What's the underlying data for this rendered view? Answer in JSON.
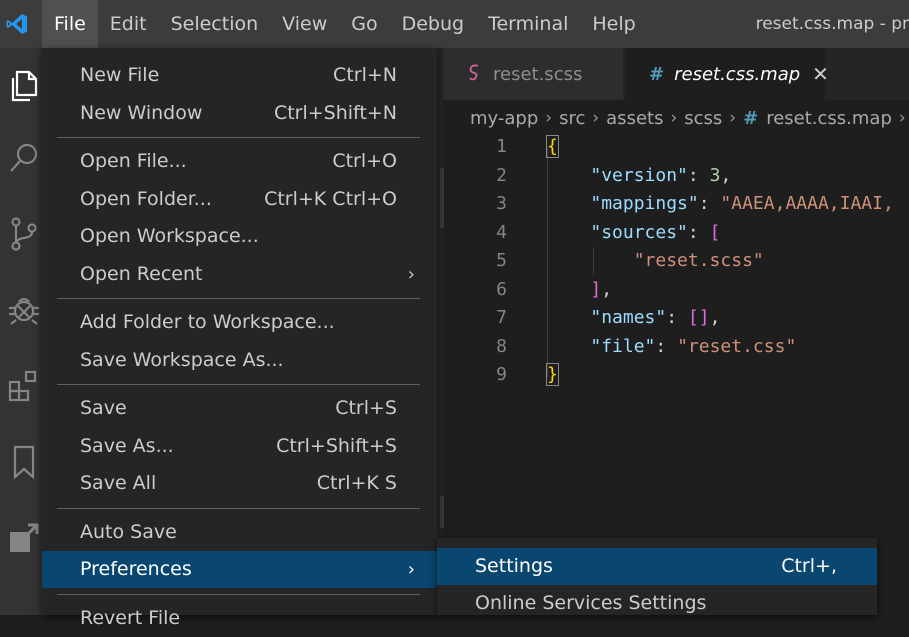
{
  "window_title": "reset.css.map - pr",
  "menubar": [
    "File",
    "Edit",
    "Selection",
    "View",
    "Go",
    "Debug",
    "Terminal",
    "Help"
  ],
  "activity_icons": [
    "explorer-icon",
    "search-icon",
    "source-control-icon",
    "debug-icon",
    "extensions-icon",
    "bookmark-icon",
    "remote-icon"
  ],
  "tabs": [
    {
      "label": "reset.scss",
      "icon": "sass-icon"
    },
    {
      "label": "reset.css.map",
      "icon": "#"
    }
  ],
  "breadcrumb": [
    "my-app",
    "src",
    "assets",
    "scss",
    "reset.css.map"
  ],
  "code": {
    "line_numbers": [
      "1",
      "2",
      "3",
      "4",
      "5",
      "6",
      "7",
      "8",
      "9"
    ],
    "lines": [
      [
        {
          "c": "b1",
          "t": "{"
        }
      ],
      [
        {
          "c": "p",
          "t": "    "
        },
        {
          "c": "k",
          "t": "\"version\""
        },
        {
          "c": "p",
          "t": ": "
        },
        {
          "c": "n",
          "t": "3"
        },
        {
          "c": "p",
          "t": ","
        }
      ],
      [
        {
          "c": "p",
          "t": "    "
        },
        {
          "c": "k",
          "t": "\"mappings\""
        },
        {
          "c": "p",
          "t": ": "
        },
        {
          "c": "s",
          "t": "\"AAEA,AAAA,IAAI,"
        }
      ],
      [
        {
          "c": "p",
          "t": "    "
        },
        {
          "c": "k",
          "t": "\"sources\""
        },
        {
          "c": "p",
          "t": ": "
        },
        {
          "c": "b2",
          "t": "["
        }
      ],
      [
        {
          "c": "p",
          "t": "        "
        },
        {
          "c": "s",
          "t": "\"reset.scss\""
        }
      ],
      [
        {
          "c": "p",
          "t": "    "
        },
        {
          "c": "b2",
          "t": "]"
        },
        {
          "c": "p",
          "t": ","
        }
      ],
      [
        {
          "c": "p",
          "t": "    "
        },
        {
          "c": "k",
          "t": "\"names\""
        },
        {
          "c": "p",
          "t": ": "
        },
        {
          "c": "b2",
          "t": "[]"
        },
        {
          "c": "p",
          "t": ","
        }
      ],
      [
        {
          "c": "p",
          "t": "    "
        },
        {
          "c": "k",
          "t": "\"file\""
        },
        {
          "c": "p",
          "t": ": "
        },
        {
          "c": "s",
          "t": "\"reset.css\""
        }
      ],
      [
        {
          "c": "b1",
          "t": "}"
        }
      ]
    ]
  },
  "file_menu": {
    "groups": [
      [
        {
          "label": "New File",
          "shortcut": "Ctrl+N"
        },
        {
          "label": "New Window",
          "shortcut": "Ctrl+Shift+N"
        }
      ],
      [
        {
          "label": "Open File...",
          "shortcut": "Ctrl+O"
        },
        {
          "label": "Open Folder...",
          "shortcut": "Ctrl+K Ctrl+O"
        },
        {
          "label": "Open Workspace...",
          "shortcut": ""
        },
        {
          "label": "Open Recent",
          "shortcut": "",
          "submenu": true
        }
      ],
      [
        {
          "label": "Add Folder to Workspace...",
          "shortcut": ""
        },
        {
          "label": "Save Workspace As...",
          "shortcut": ""
        }
      ],
      [
        {
          "label": "Save",
          "shortcut": "Ctrl+S"
        },
        {
          "label": "Save As...",
          "shortcut": "Ctrl+Shift+S"
        },
        {
          "label": "Save All",
          "shortcut": "Ctrl+K S"
        }
      ],
      [
        {
          "label": "Auto Save",
          "shortcut": ""
        },
        {
          "label": "Preferences",
          "shortcut": "",
          "submenu": true,
          "highlighted": true
        }
      ],
      [
        {
          "label": "Revert File",
          "shortcut": ""
        }
      ]
    ]
  },
  "preferences_submenu": [
    {
      "label": "Settings",
      "shortcut": "Ctrl+,",
      "highlighted": true
    },
    {
      "label": "Online Services Settings",
      "shortcut": ""
    }
  ],
  "colors": {
    "accent": "#007acc",
    "highlight": "#094771",
    "menu_bg": "#252526",
    "titlebar_bg": "#3c3c3c"
  }
}
